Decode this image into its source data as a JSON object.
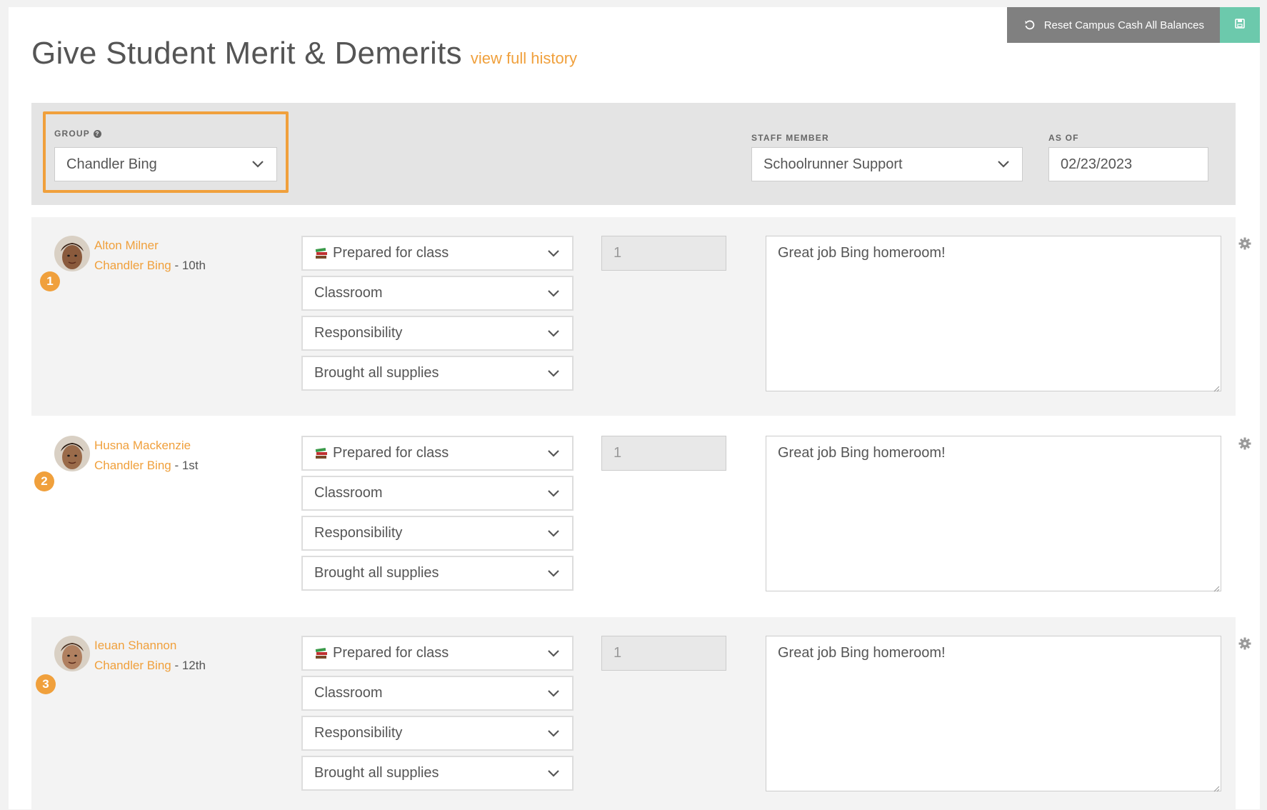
{
  "header": {
    "title": "Give Student Merit & Demerits",
    "history_link": "view full history",
    "reset_button": "Reset Campus Cash All Balances",
    "reset_icon": "undo-icon",
    "save_icon": "save-icon"
  },
  "filters": {
    "group_label": "GROUP",
    "group_value": "Chandler Bing",
    "staff_label": "STAFF MEMBER",
    "staff_value": "Schoolrunner Support",
    "asof_label": "AS OF",
    "asof_value": "02/23/2023"
  },
  "students": [
    {
      "number": "1",
      "name": "Alton Milner",
      "group": "Chandler Bing",
      "grade": " - 10th",
      "behavior": "Prepared for class",
      "category": "Classroom",
      "subcategory": "Responsibility",
      "detail": "Brought all supplies",
      "points": "1",
      "comment": "Great job Bing homeroom!"
    },
    {
      "number": "2",
      "name": "Husna Mackenzie",
      "group": "Chandler Bing",
      "grade": " - 1st",
      "behavior": "Prepared for class",
      "category": "Classroom",
      "subcategory": "Responsibility",
      "detail": "Brought all supplies",
      "points": "1",
      "comment": "Great job Bing homeroom!"
    },
    {
      "number": "3",
      "name": "Ieuan Shannon",
      "group": "Chandler Bing",
      "grade": " - 12th",
      "behavior": "Prepared for class",
      "category": "Classroom",
      "subcategory": "Responsibility",
      "detail": "Brought all supplies",
      "points": "1",
      "comment": "Great job Bing homeroom!"
    }
  ],
  "colors": {
    "accent": "#f0a03c",
    "save": "#6cc9ac",
    "reset": "#808080"
  }
}
